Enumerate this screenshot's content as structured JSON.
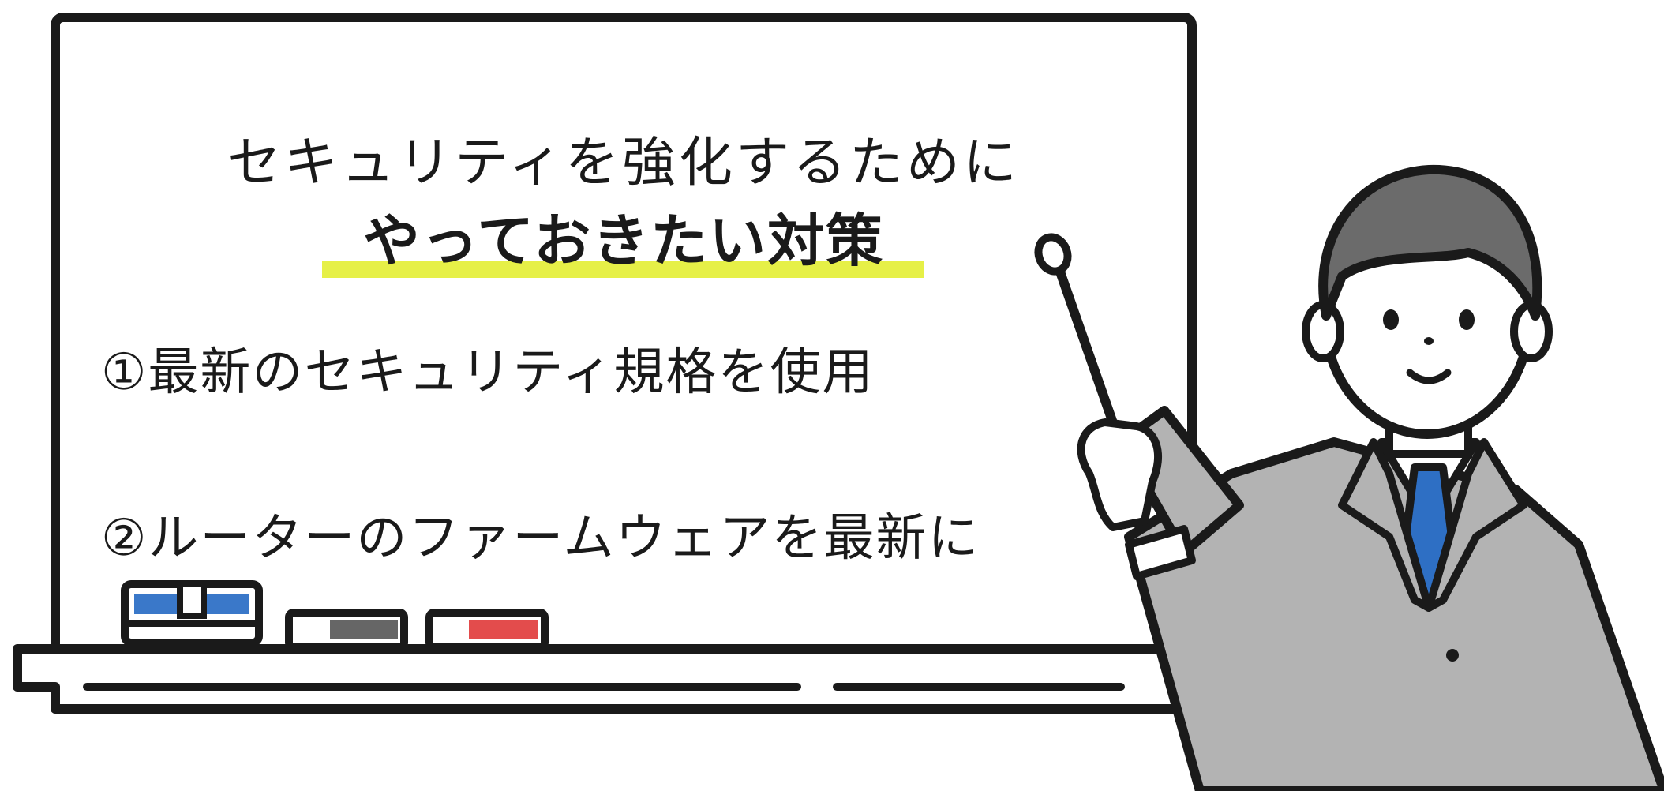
{
  "board": {
    "title_line1": "セキュリティを強化するために",
    "title_line2": "やっておきたい対策",
    "items": [
      "①最新のセキュリティ規格を使用",
      "②ルーターのファームウェアを最新に"
    ]
  },
  "colors": {
    "highlight": "#e6f047",
    "outline": "#1a1a1a",
    "hair": "#6b6b6b",
    "suit": "#b3b3b3",
    "tie": "#2e6fc4",
    "marker_blue": "#3a78c9",
    "marker_red": "#e34c4c",
    "marker_gray": "#666666"
  },
  "icons": {
    "figure": "presenter-teacher-icon",
    "pointer": "pointer-stick-icon",
    "eraser": "eraser-icon"
  }
}
